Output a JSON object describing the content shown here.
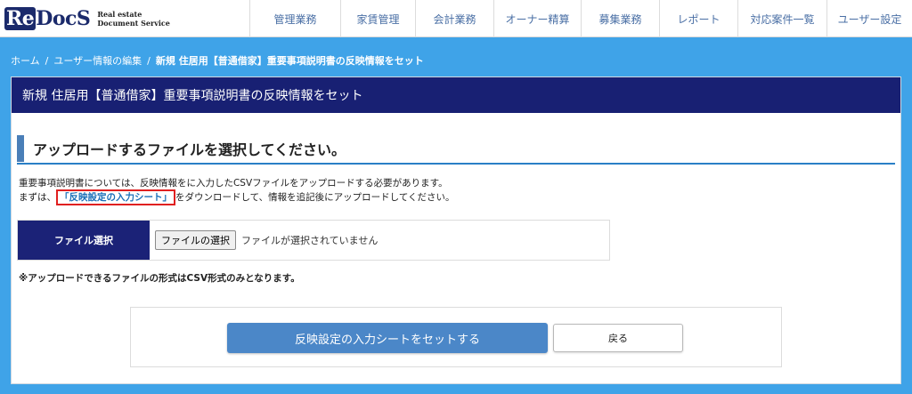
{
  "brand": {
    "logo_re": "Re",
    "logo_docs": "DocS",
    "tagline_line1": "Real estate",
    "tagline_line2": "Document Service"
  },
  "nav": [
    {
      "label": "管理業務",
      "width": 102
    },
    {
      "label": "家賃管理",
      "width": 84
    },
    {
      "label": "会計業務",
      "width": 88
    },
    {
      "label": "オーナー精算",
      "width": 98
    },
    {
      "label": "募集業務",
      "width": 88
    },
    {
      "label": "レポート",
      "width": 88
    },
    {
      "label": "対応案件一覧",
      "width": 100
    },
    {
      "label": "ユーザー設定",
      "width": 96
    }
  ],
  "breadcrumb": {
    "home": "ホーム",
    "separator": "/",
    "user_edit": "ユーザー情報の編集",
    "current": "新規 住居用【普通借家】重要事項説明書の反映情報をセット"
  },
  "panel": {
    "title": "新規 住居用【普通借家】重要事項説明書の反映情報をセット",
    "section_heading": "アップロードするファイルを選択してください。",
    "desc_line1": "重要事項説明書については、反映情報をに入力したCSVファイルをアップロードする必要があります。",
    "desc_line2_prefix": "まずは、",
    "desc_link": "「反映設定の入力シート」",
    "desc_line2_suffix": "をダウンロードして、情報を追記後にアップロードしてください。",
    "file_label": "ファイル選択",
    "file_button": "ファイルの選択",
    "file_status": "ファイルが選択されていません",
    "note": "※アップロードできるファイルの形式はCSV形式のみとなります。",
    "submit_button": "反映設定の入力シートをセットする",
    "back_button": "戻る"
  },
  "colors": {
    "page_bg": "#3fa3e8",
    "panel_title_bg": "#182073",
    "primary_button": "#4b87c8",
    "highlight_border": "#e02020"
  }
}
